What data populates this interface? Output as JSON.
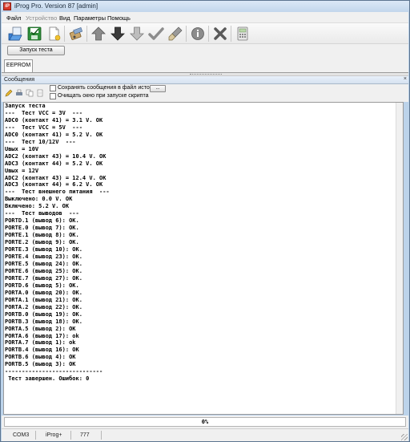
{
  "window": {
    "title": "iProg Pro. Version 87 [admin]",
    "app_icon_letter": "iP"
  },
  "menu": {
    "items": [
      {
        "label": "Файл",
        "enabled": true
      },
      {
        "label": "Устройство",
        "enabled": false
      },
      {
        "label": "Вид",
        "enabled": true
      },
      {
        "label": "Параметры",
        "enabled": true
      },
      {
        "label": "Помощь",
        "enabled": true
      }
    ]
  },
  "toolbar": {
    "buttons": [
      {
        "icon": "open-icon"
      },
      {
        "icon": "save-icon"
      },
      {
        "icon": "new-file-icon"
      },
      {
        "icon": "chip-tools-icon"
      },
      {
        "icon": "arrow-up-icon"
      },
      {
        "icon": "arrow-down-icon"
      },
      {
        "icon": "arrow-down-outline-icon"
      },
      {
        "icon": "checkmark-icon"
      },
      {
        "icon": "erase-brush-icon"
      },
      {
        "icon": "info-icon"
      },
      {
        "icon": "cancel-x-icon"
      },
      {
        "icon": "calculator-icon"
      }
    ]
  },
  "actions": {
    "run_test_label": "Запуск теста"
  },
  "tabs": [
    {
      "label": "EEPROM"
    }
  ],
  "messages_panel": {
    "title": "Сообщения",
    "close_glyph": "×",
    "save_history_label": "Сохранять сообщения в файл истории",
    "browse_label": "...",
    "clear_on_run_label": "Очищать окно при запуске скрипта"
  },
  "log_lines": [
    "Запуск теста",
    "---  Тест VCC = 3V  ---",
    "ADC0 (контакт 41) = 3.1 V. OK",
    "---  Тест VCC = 5V  ---",
    "ADC0 (контакт 41) = 5.2 V. OK",
    "---  Тест 10/12V  ---",
    "Uвых = 10V",
    "ADC2 (контакт 43) = 10.4 V. OK",
    "ADC3 (контакт 44) = 5.2 V. OK",
    "Uвых = 12V",
    "ADC2 (контакт 43) = 12.4 V. OK",
    "ADC3 (контакт 44) = 6.2 V. OK",
    "---  Тест внешнего питания  ---",
    "Выключено: 0.0 V. OK",
    "Включено: 5.2 V. OK",
    "---  Тест выводов  ---",
    "PORTD.1 (вывод 6): OK.",
    "PORTE.0 (вывод 7): OK.",
    "PORTE.1 (вывод 8): OK.",
    "PORTE.2 (вывод 9): OK.",
    "PORTE.3 (вывод 10): OK.",
    "PORTE.4 (вывод 23): OK.",
    "PORTE.5 (вывод 24): OK.",
    "PORTE.6 (вывод 25): OK.",
    "PORTE.7 (вывод 27): OK.",
    "PORTD.6 (вывод 5): OK.",
    "PORTA.0 (вывод 20): OK.",
    "PORTA.1 (вывод 21): OK.",
    "PORTA.2 (вывод 22): OK.",
    "PORTB.0 (вывод 19): OK.",
    "PORTB.3 (вывод 18): OK.",
    "PORTA.5 (вывод 2): OK",
    "PORTA.6 (вывод 17): ok",
    "PORTA.7 (вывод 1): ok",
    "PORTB.4 (вывод 16): OK",
    "PORTB.6 (вывод 4): OK",
    "PORTB.5 (вывод 3): OK",
    "-----------------------------",
    " Тест завершен. Ошибок: 0"
  ],
  "progress": {
    "percent": 0,
    "label": "0%"
  },
  "status": {
    "port": "COM3",
    "device": "iProg+",
    "version": "777"
  },
  "colors": {
    "accent": "#06b025",
    "window_bg": "#bcd3ea",
    "panel_bg": "#f0f0f0"
  }
}
